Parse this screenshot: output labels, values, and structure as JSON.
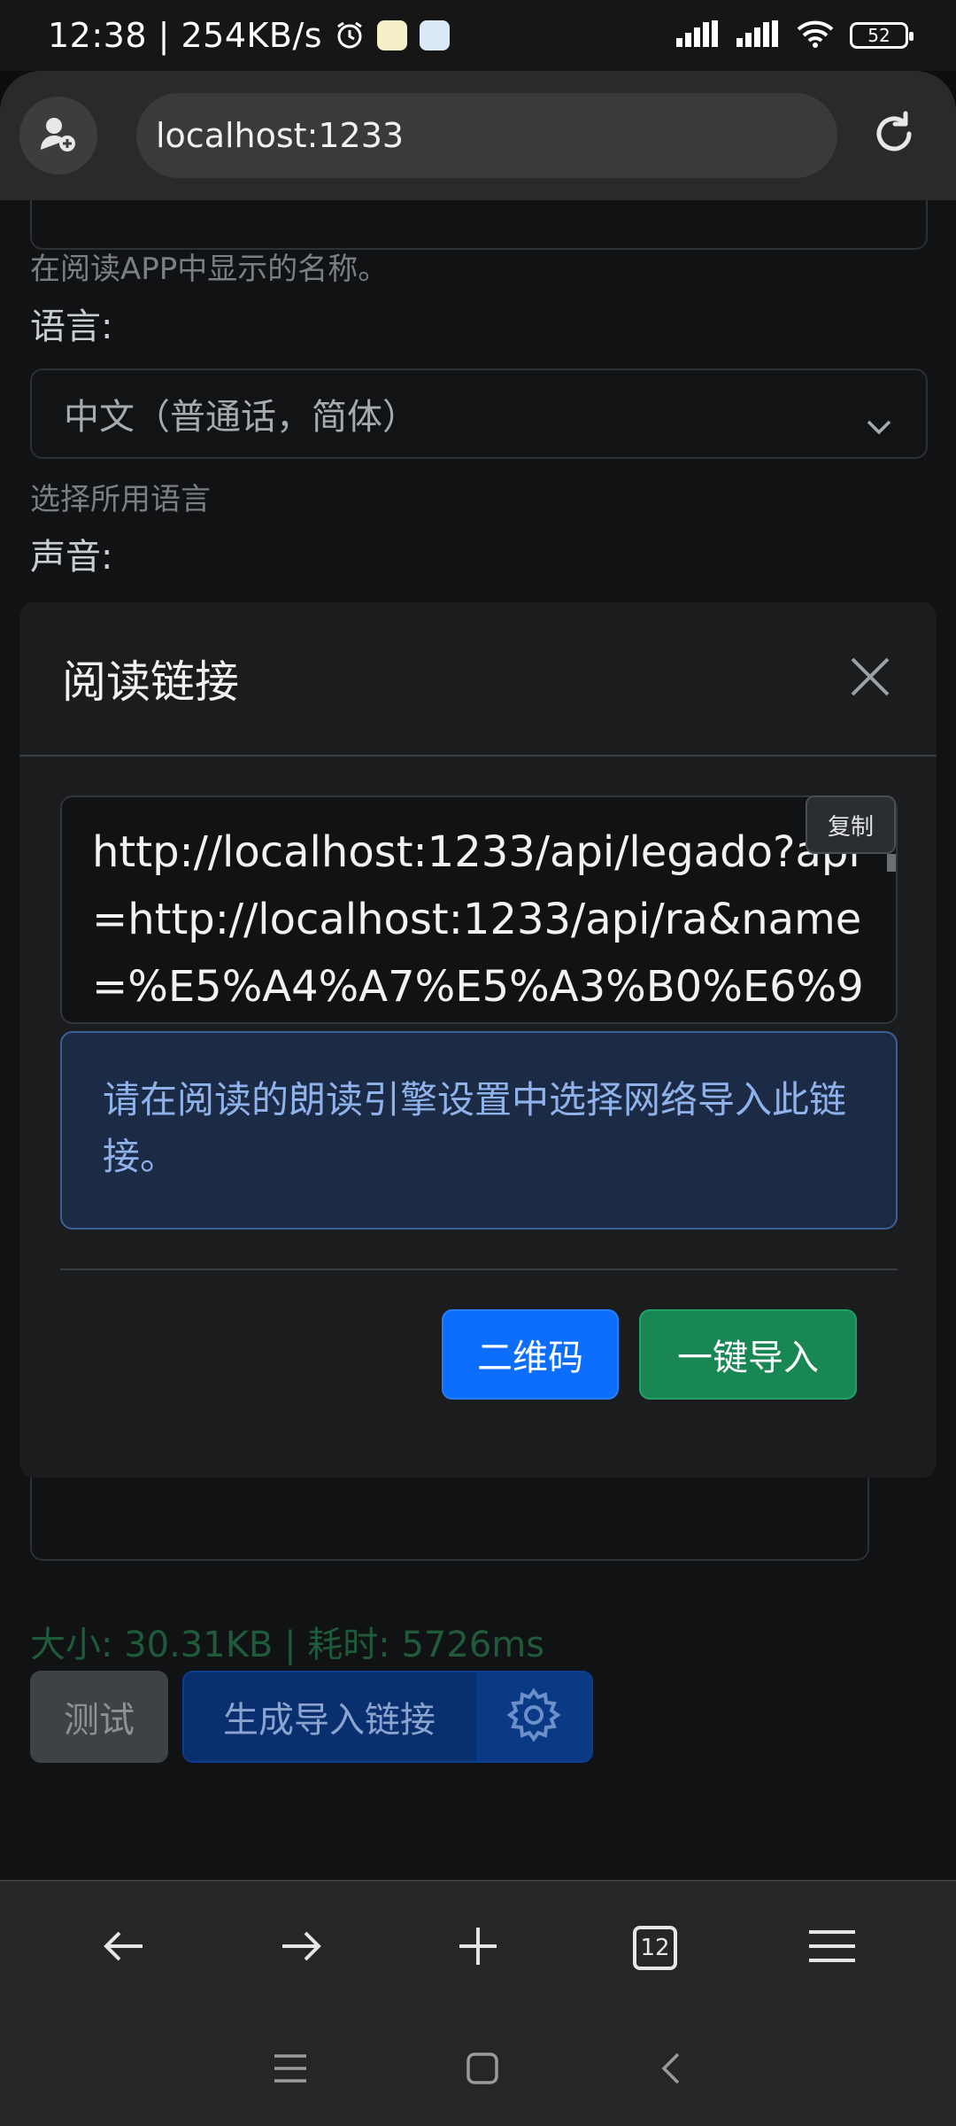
{
  "status_bar": {
    "time": "12:38 | 254KB/s",
    "battery": "52",
    "icons": [
      "alarm-icon",
      "app-notification-icon",
      "app-notification-icon",
      "signal-icon",
      "signal-icon",
      "wifi-icon",
      "battery-icon"
    ]
  },
  "browser": {
    "url": "localhost:1233",
    "tabs_count": "12"
  },
  "form": {
    "name_hint": "在阅读APP中显示的名称。",
    "language_label": "语言:",
    "language_value": "中文（普通话，简体）",
    "language_hint": "选择所用语言",
    "voice_label": "声音:",
    "stats": "大小: 30.31KB | 耗时: 5726ms",
    "test_button": "测试",
    "generate_button": "生成导入链接"
  },
  "modal": {
    "title": "阅读链接",
    "link": "http://localhost:1233/api/legado?api=http://localhost:1233/api/ra&name=%E5%A4%A7%E5%A3%B0%E6%9",
    "copy_button": "复制",
    "info": "请在阅读的朗读引擎设置中选择网络导入此链接。",
    "qr_button": "二维码",
    "import_button": "一键导入"
  },
  "colors": {
    "primary": "#0d6efd",
    "success": "#198754",
    "info_bg": "#1c2b45",
    "info_text": "#8fb2ea"
  }
}
